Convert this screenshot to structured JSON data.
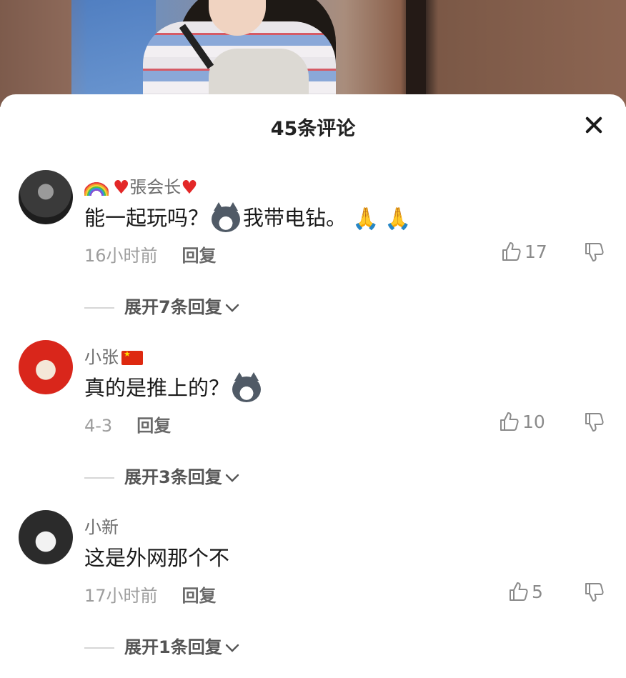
{
  "header": {
    "title": "45条评论"
  },
  "comments": [
    {
      "user": "張会长",
      "text": "能一起玩吗？",
      "text_after_dog": "我带电钻。",
      "time": "16小时前",
      "reply": "回复",
      "likes": "17",
      "expand": "展开7条回复"
    },
    {
      "user": "小张",
      "text": "真的是推上的？",
      "time": "4-3",
      "reply": "回复",
      "likes": "10",
      "expand": "展开3条回复"
    },
    {
      "user": "小新",
      "text": "这是外网那个不",
      "time": "17小时前",
      "reply": "回复",
      "likes": "5",
      "expand": "展开1条回复"
    }
  ],
  "icons": {
    "close": "close-icon",
    "like": "thumbs-up-icon",
    "dislike": "thumbs-down-icon",
    "expand": "chevron-down-icon"
  },
  "colors": {
    "accent_heart": "#e32727",
    "text_secondary": "#9d9d9d"
  }
}
